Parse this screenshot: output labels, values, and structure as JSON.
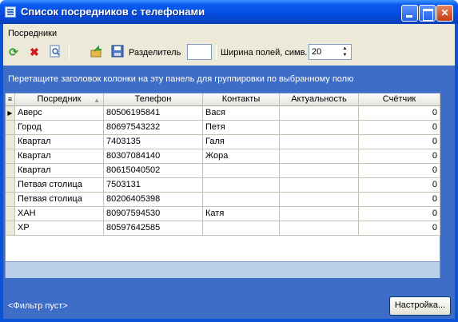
{
  "window": {
    "title": "Список посредников с телефонами"
  },
  "menu": {
    "items": [
      "Посредники"
    ]
  },
  "toolbar": {
    "separator_label": "Разделитель",
    "separator_value": "",
    "width_label": "Ширина полей, симв.",
    "width_value": "20"
  },
  "group_panel": {
    "hint": "Перетащите заголовок колонки на эту панель для группировки по выбранному полю"
  },
  "grid": {
    "columns": [
      "Посредник",
      "Телефон",
      "Контакты",
      "Актуальность",
      "Счётчик"
    ],
    "rows": [
      [
        "Аверс",
        "80506195841",
        "Вася",
        "",
        "0"
      ],
      [
        "Город",
        "80697543232",
        "Петя",
        "",
        "0"
      ],
      [
        "Квартал",
        "7403135",
        "Галя",
        "",
        "0"
      ],
      [
        "Квартал",
        "80307084140",
        "Жора",
        "",
        "0"
      ],
      [
        "Квартал",
        "80615040502",
        "",
        "",
        "0"
      ],
      [
        "Петвая столица",
        "7503131",
        "",
        "",
        "0"
      ],
      [
        "Петвая столица",
        "80206405398",
        "",
        "",
        "0"
      ],
      [
        "ХАН",
        "80907594530",
        "Катя",
        "",
        "0"
      ],
      [
        "ХР",
        "80597642585",
        "",
        "",
        "0"
      ]
    ]
  },
  "filter": {
    "text": "<Фильтр пуст>",
    "settings_label": "Настройка..."
  },
  "icons": {
    "refresh": "refresh-icon",
    "delete": "delete-icon",
    "preview": "preview-icon",
    "export": "export-icon",
    "save": "save-icon"
  }
}
